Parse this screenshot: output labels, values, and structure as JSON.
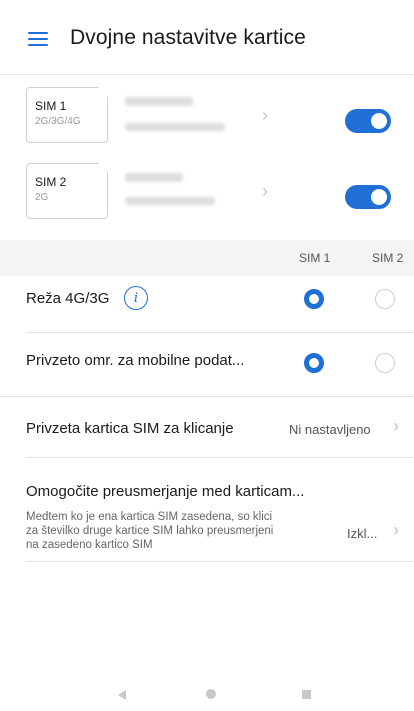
{
  "header": {
    "title": "Dvojne nastavitve kartice",
    "menu_icon": "menu-icon"
  },
  "sims": [
    {
      "name": "SIM 1",
      "network": "2G/3G/4G",
      "enabled": true
    },
    {
      "name": "SIM 2",
      "network": "2G",
      "enabled": true
    }
  ],
  "columns": {
    "sim1": "SIM 1",
    "sim2": "SIM 2"
  },
  "network_rows": [
    {
      "label": "Reža 4G/3G",
      "selected": "SIM 1"
    },
    {
      "label": "Privzeto omr. za mobilne podat...",
      "selected": "SIM 1"
    }
  ],
  "calling": {
    "label": "Privzeta kartica SIM za klicanje",
    "value": "Ni nastavljeno"
  },
  "forwarding": {
    "label": "Omogočite preusmerjanje med karticam...",
    "desc_line1": "Medtem ko je ena kartica SIM zasedena, so klici",
    "desc_line2": "za številko druge kartice SIM lahko preusmerjeni",
    "desc_line3": "na zasedeno kartico SIM",
    "value": "Izkl..."
  },
  "colors": {
    "accent": "#1f6fd6"
  }
}
